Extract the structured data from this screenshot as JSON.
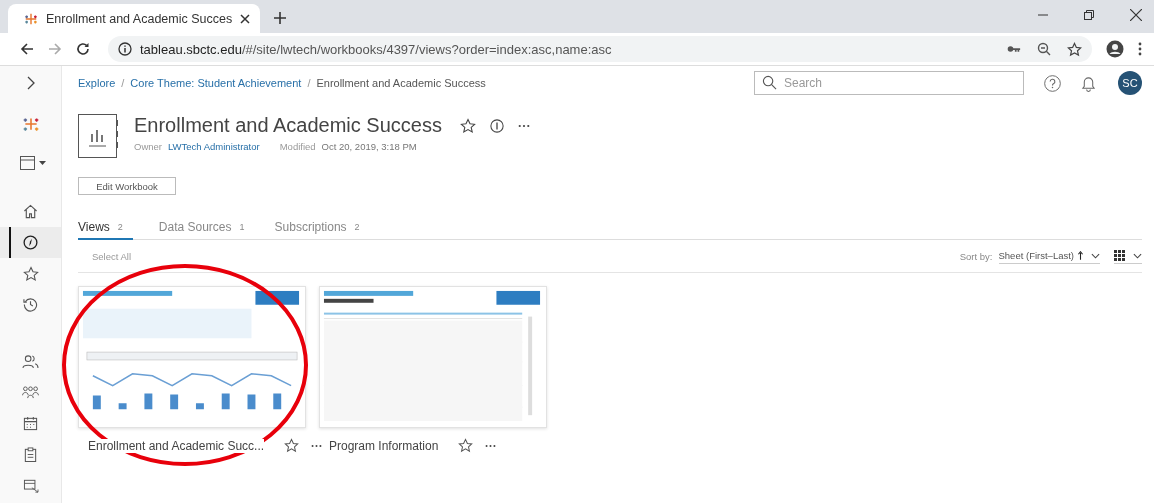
{
  "browser": {
    "tab": {
      "title": "Enrollment and Academic Succes",
      "selected": true
    },
    "url": {
      "host": "tableau.sbctc.edu",
      "path": "/#/site/lwtech/workbooks/4397/views?order=index:asc,name:asc"
    }
  },
  "sidebar": {
    "items": [
      {
        "kind": "expand",
        "selected": false
      },
      {
        "kind": "logo",
        "selected": false
      },
      {
        "kind": "content",
        "selected": false
      },
      {
        "kind": "home",
        "selected": false
      },
      {
        "kind": "explore",
        "selected": true
      },
      {
        "kind": "favorites",
        "selected": false
      },
      {
        "kind": "recents",
        "selected": false
      },
      {
        "kind": "users",
        "selected": false
      },
      {
        "kind": "groups",
        "selected": false
      },
      {
        "kind": "schedules",
        "selected": false
      },
      {
        "kind": "tasks",
        "selected": false
      },
      {
        "kind": "data",
        "selected": false
      }
    ]
  },
  "breadcrumb": [
    {
      "label": "Explore",
      "link": true
    },
    {
      "separator": "/",
      "label": "Core Theme: Student Achievement",
      "link": true
    },
    {
      "separator": "/",
      "label": "Enrollment and Academic Success",
      "link": false
    }
  ],
  "search": {
    "placeholder": "Search"
  },
  "user": {
    "initials": "SC"
  },
  "workbook": {
    "title": "Enrollment and Academic Success",
    "owner_label": "Owner",
    "owner": "LWTech Administrator",
    "modified_label": "Modified",
    "modified": "Oct 20, 2019, 3:18 PM",
    "favorite": false
  },
  "edit_button": "Edit Workbook",
  "tabs": [
    {
      "label": "Views",
      "count": "2",
      "selected": true
    },
    {
      "label": "Data Sources",
      "count": "1",
      "selected": false
    },
    {
      "label": "Subscriptions",
      "count": "2",
      "selected": false
    }
  ],
  "select_all": "Select All",
  "sort": {
    "label": "Sort by:",
    "value": "Sheet (First–Last)"
  },
  "views": [
    {
      "title": "Enrollment and Academic Succ...",
      "favorite": false
    },
    {
      "title": "Program Information",
      "favorite": false
    }
  ],
  "annotations": [
    {
      "kind": "ellipse",
      "color": "#e8000b"
    }
  ]
}
